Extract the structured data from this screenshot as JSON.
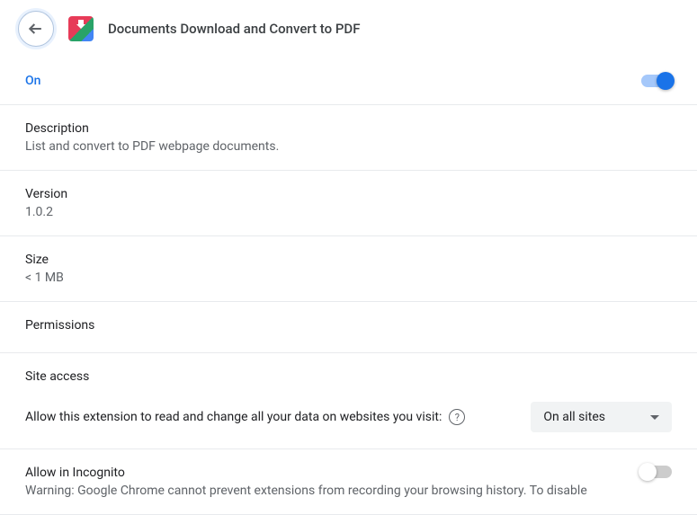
{
  "header": {
    "title": "Documents Download and Convert to PDF"
  },
  "status": {
    "label": "On",
    "enabled": true
  },
  "description": {
    "title": "Description",
    "value": "List and convert to PDF webpage documents."
  },
  "version": {
    "title": "Version",
    "value": "1.0.2"
  },
  "size": {
    "title": "Size",
    "value": "< 1 MB"
  },
  "permissions": {
    "title": "Permissions"
  },
  "site_access": {
    "title": "Site access",
    "description": "Allow this extension to read and change all your data on websites you visit:",
    "selected": "On all sites"
  },
  "incognito": {
    "title": "Allow in Incognito",
    "warning": "Warning: Google Chrome cannot prevent extensions from recording your browsing history. To disable",
    "enabled": false
  }
}
